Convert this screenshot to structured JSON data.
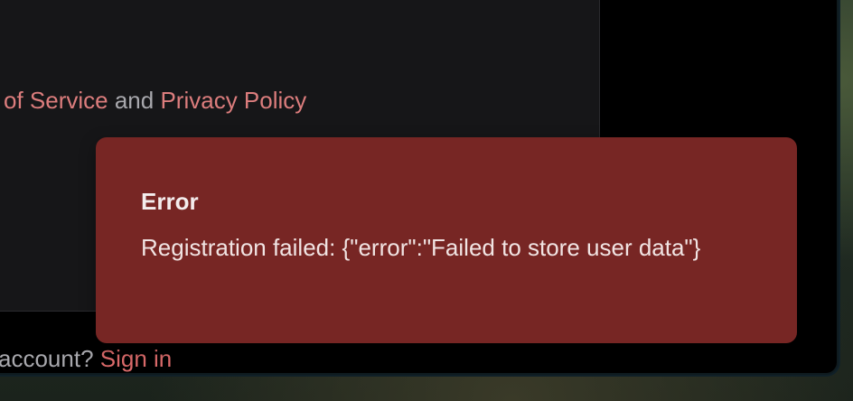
{
  "form": {
    "terms_tail": "of Service",
    "terms_and": "and",
    "privacy_link": "Privacy Policy",
    "signin_prompt": "account?",
    "signin_link": "Sign in"
  },
  "toast": {
    "title": "Error",
    "message": "Registration failed: {\"error\":\"Failed to store user data\"}"
  },
  "colors": {
    "toast_bg": "#772624",
    "link": "#dc7d7d",
    "card_bg": "#161618"
  }
}
